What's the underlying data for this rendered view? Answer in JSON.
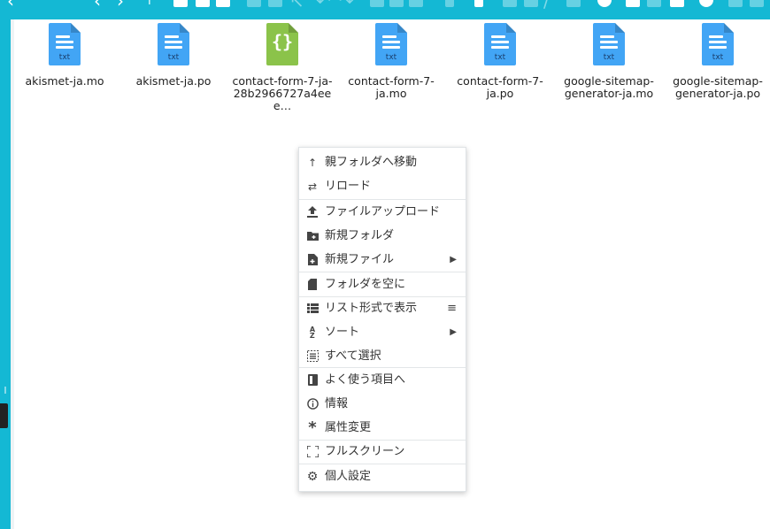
{
  "toolbar": {
    "icons": [
      "back-icon",
      "forward-icon",
      "up-icon",
      "new-folder-icon",
      "new-file-icon",
      "upload-icon",
      "download-icon",
      "rename-icon",
      "undo-icon",
      "redo-icon",
      "copy-icon",
      "cut-icon",
      "paste-icon",
      "delete-icon",
      "empty-icon",
      "duplicate-icon",
      "edit-icon",
      "resize-icon",
      "archive-icon",
      "extract-icon",
      "info-icon",
      "select-all-icon",
      "fullscreen-icon",
      "view-icon",
      "settings-icon",
      "help-icon"
    ]
  },
  "files": [
    {
      "name": "akismet-ja.mo",
      "ext": "txt",
      "kind": "text"
    },
    {
      "name": "akismet-ja.po",
      "ext": "txt",
      "kind": "text"
    },
    {
      "name": "contact-form-7-ja-28b2966727a4eee…",
      "ext": "{}",
      "kind": "json"
    },
    {
      "name": "contact-form-7-ja.mo",
      "ext": "txt",
      "kind": "text"
    },
    {
      "name": "contact-form-7-ja.po",
      "ext": "txt",
      "kind": "text"
    },
    {
      "name": "google-sitemap-generator-ja.mo",
      "ext": "txt",
      "kind": "text"
    },
    {
      "name": "google-sitemap-generator-ja.po",
      "ext": "txt",
      "kind": "text"
    }
  ],
  "context_menu": {
    "items": [
      {
        "label": "親フォルダへ移動",
        "icon": "arrow-up-icon"
      },
      {
        "label": "リロード",
        "icon": "reload-icon"
      },
      {
        "label": "ファイルアップロード",
        "icon": "upload-icon"
      },
      {
        "label": "新規フォルダ",
        "icon": "folder-add-icon"
      },
      {
        "label": "新規ファイル",
        "icon": "file-add-icon",
        "submenu": true
      },
      {
        "label": "フォルダを空に",
        "icon": "empty-folder-icon"
      },
      {
        "label": "リスト形式で表示",
        "icon": "list-view-icon"
      },
      {
        "label": "ソート",
        "icon": "sort-az-icon",
        "submenu": true
      },
      {
        "label": "すべて選択",
        "icon": "select-all-icon"
      },
      {
        "label": "よく使う項目へ",
        "icon": "bookmark-icon"
      },
      {
        "label": "情報",
        "icon": "info-icon"
      },
      {
        "label": "属性変更",
        "icon": "asterisk-icon"
      },
      {
        "label": "フルスクリーン",
        "icon": "fullscreen-icon"
      },
      {
        "label": "個人設定",
        "icon": "gear-icon"
      }
    ]
  },
  "colors": {
    "accent": "#14b8d4",
    "text_file_icon": "#42a5f5",
    "json_file_icon": "#8bc34a"
  }
}
